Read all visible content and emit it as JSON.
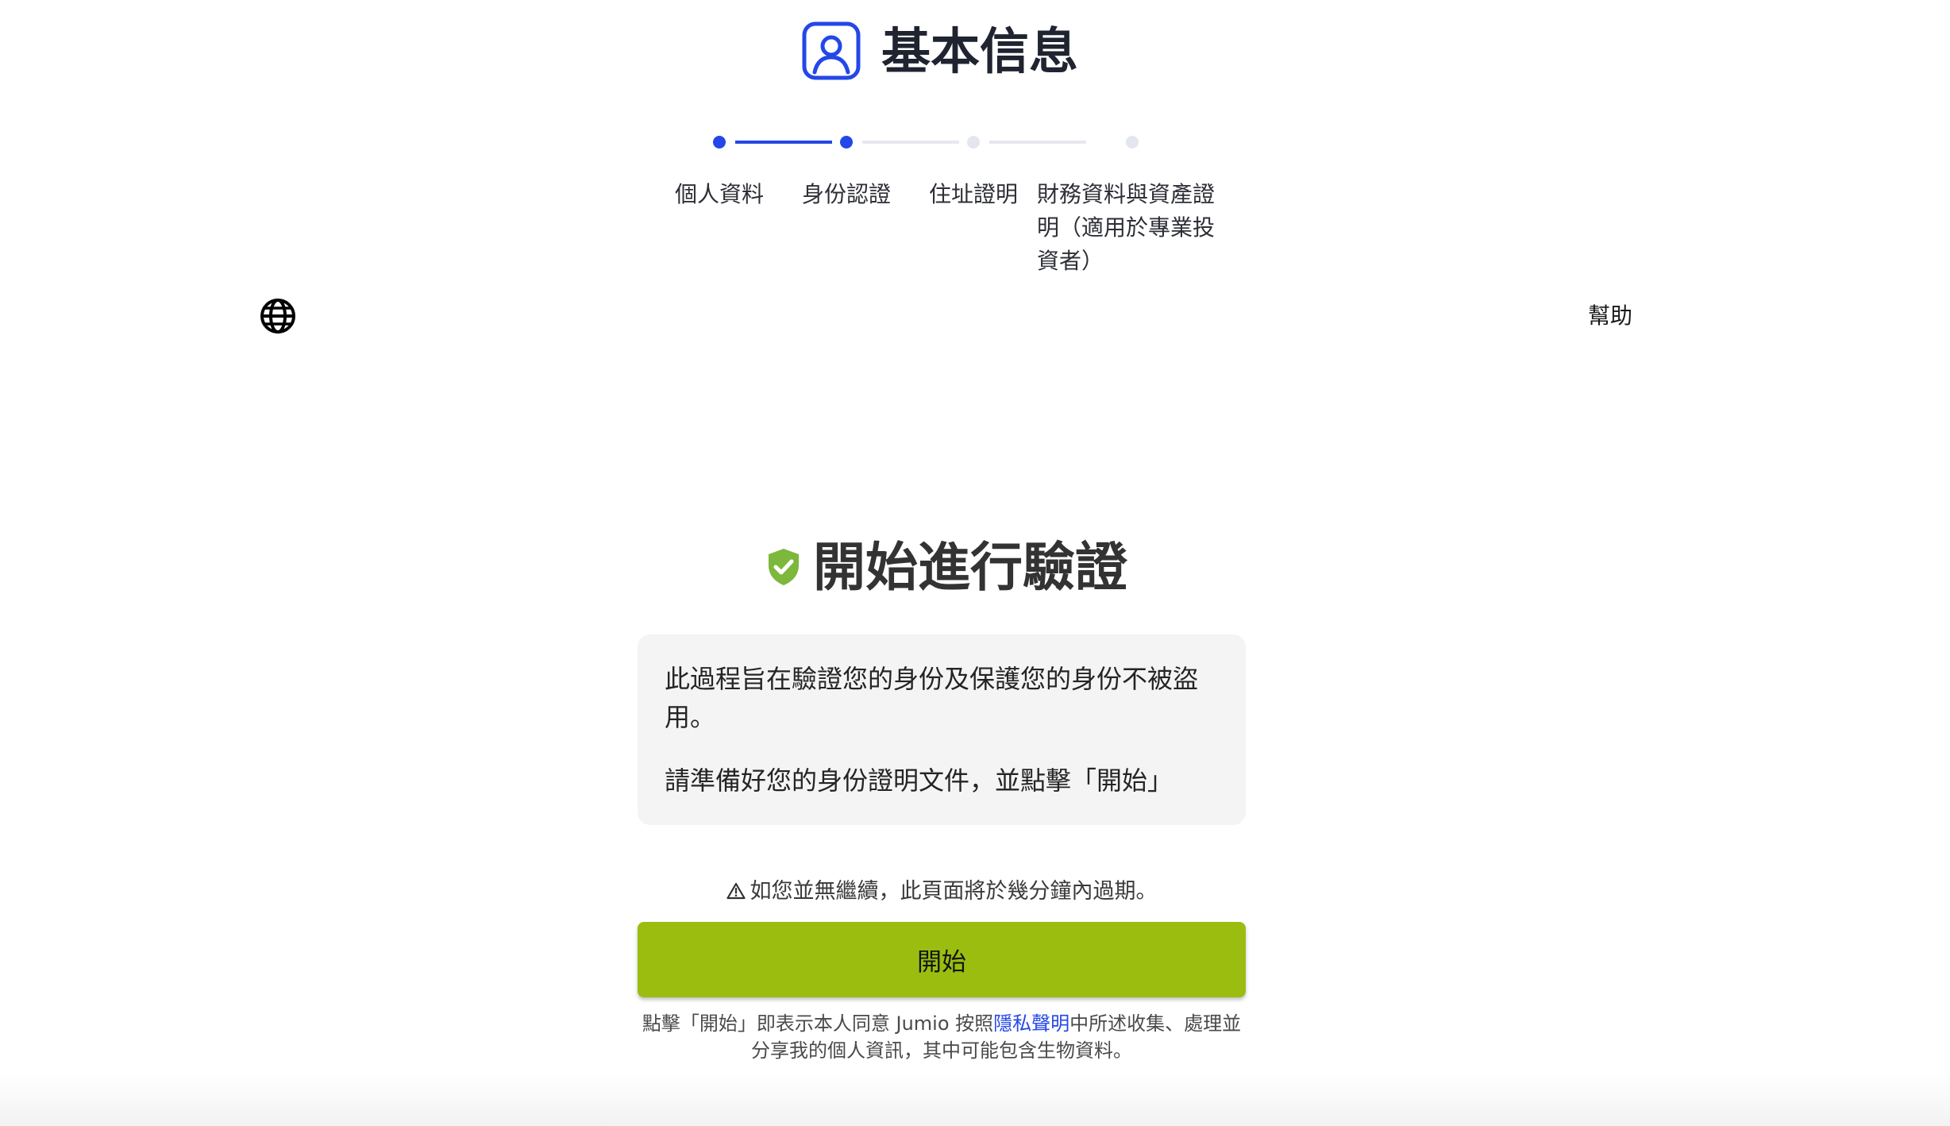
{
  "header": {
    "title": "基本信息",
    "icon": "user-profile-icon"
  },
  "stepper": {
    "steps": [
      {
        "label": "個人資料",
        "state": "completed"
      },
      {
        "label": "身份認證",
        "state": "current"
      },
      {
        "label": "住址證明",
        "state": "upcoming"
      },
      {
        "label": "財務資料與資產證明（適用於專業投資者）",
        "state": "upcoming"
      }
    ],
    "active_color": "#2447e8",
    "inactive_color": "#e4e6ef"
  },
  "toolbar": {
    "language_icon": "globe-icon",
    "help_label": "幫助"
  },
  "verification": {
    "title": "開始進行驗證",
    "title_icon": "shield-check-icon",
    "info_para_1": "此過程旨在驗證您的身份及保護您的身份不被盜用。",
    "info_para_2": "請準備好您的身份證明文件，並點擊「開始」",
    "warning_icon": "warning-icon",
    "warning_text": "如您並無繼續，此頁面將於幾分鐘內過期。",
    "start_button_label": "開始",
    "button_color": "#9abd10",
    "consent_before": "點擊「開始」即表示本人同意 Jumio 按照",
    "consent_link": "隱私聲明",
    "consent_after": "中所述收集、處理並分享我的個人資訊，其中可能包含生物資料。"
  }
}
